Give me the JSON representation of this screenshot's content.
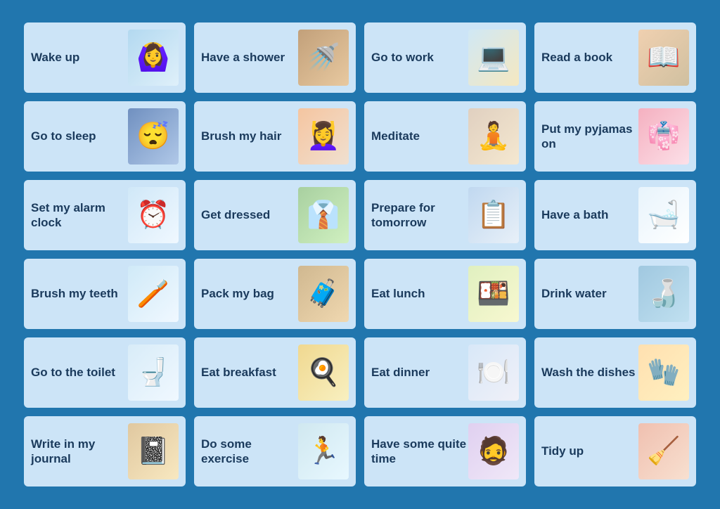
{
  "cards": [
    {
      "id": "wake-up",
      "label": "Wake up",
      "emoji": "🙆‍♀️",
      "illClass": "ill-wake"
    },
    {
      "id": "shower",
      "label": "Have a shower",
      "emoji": "🚿",
      "illClass": "ill-shower"
    },
    {
      "id": "work",
      "label": "Go to work",
      "emoji": "💻",
      "illClass": "ill-work"
    },
    {
      "id": "readbook",
      "label": "Read a book",
      "emoji": "📖",
      "illClass": "ill-readbook"
    },
    {
      "id": "sleep",
      "label": "Go to sleep",
      "emoji": "😴",
      "illClass": "ill-sleep"
    },
    {
      "id": "brushhair",
      "label": "Brush my hair",
      "emoji": "💆‍♀️",
      "illClass": "ill-brushhair"
    },
    {
      "id": "meditate",
      "label": "Meditate",
      "emoji": "🧘",
      "illClass": "ill-meditate"
    },
    {
      "id": "pyjamas",
      "label": "Put my pyjamas on",
      "emoji": "👘",
      "illClass": "ill-pyjamas"
    },
    {
      "id": "alarm",
      "label": "Set my alarm clock",
      "emoji": "⏰",
      "illClass": "ill-alarm"
    },
    {
      "id": "dressed",
      "label": "Get dressed",
      "emoji": "👔",
      "illClass": "ill-dressed"
    },
    {
      "id": "tomorrow",
      "label": "Prepare for tomorrow",
      "emoji": "📋",
      "illClass": "ill-tomorrow"
    },
    {
      "id": "bath",
      "label": "Have a bath",
      "emoji": "🛁",
      "illClass": "ill-bath"
    },
    {
      "id": "teeth",
      "label": "Brush my teeth",
      "emoji": "🪥",
      "illClass": "ill-teeth"
    },
    {
      "id": "bag",
      "label": "Pack my bag",
      "emoji": "🧳",
      "illClass": "ill-bag"
    },
    {
      "id": "lunch",
      "label": "Eat lunch",
      "emoji": "🍱",
      "illClass": "ill-lunch"
    },
    {
      "id": "water",
      "label": "Drink water",
      "emoji": "🍶",
      "illClass": "ill-water"
    },
    {
      "id": "toilet",
      "label": "Go to the toilet",
      "emoji": "🚽",
      "illClass": "ill-toilet"
    },
    {
      "id": "breakfast",
      "label": "Eat breakfast",
      "emoji": "🍳",
      "illClass": "ill-breakfast"
    },
    {
      "id": "dinner",
      "label": "Eat dinner",
      "emoji": "🍽️",
      "illClass": "ill-dinner"
    },
    {
      "id": "dishes",
      "label": "Wash the dishes",
      "emoji": "🧤",
      "illClass": "ill-dishes"
    },
    {
      "id": "journal",
      "label": "Write in my journal",
      "emoji": "📓",
      "illClass": "ill-journal"
    },
    {
      "id": "exercise",
      "label": "Do some exercise",
      "emoji": "🏃",
      "illClass": "ill-exercise"
    },
    {
      "id": "qtime",
      "label": "Have some quite time",
      "emoji": "🧔",
      "illClass": "ill-qtime"
    },
    {
      "id": "tidy",
      "label": "Tidy up",
      "emoji": "🧹",
      "illClass": "ill-tidy"
    }
  ]
}
